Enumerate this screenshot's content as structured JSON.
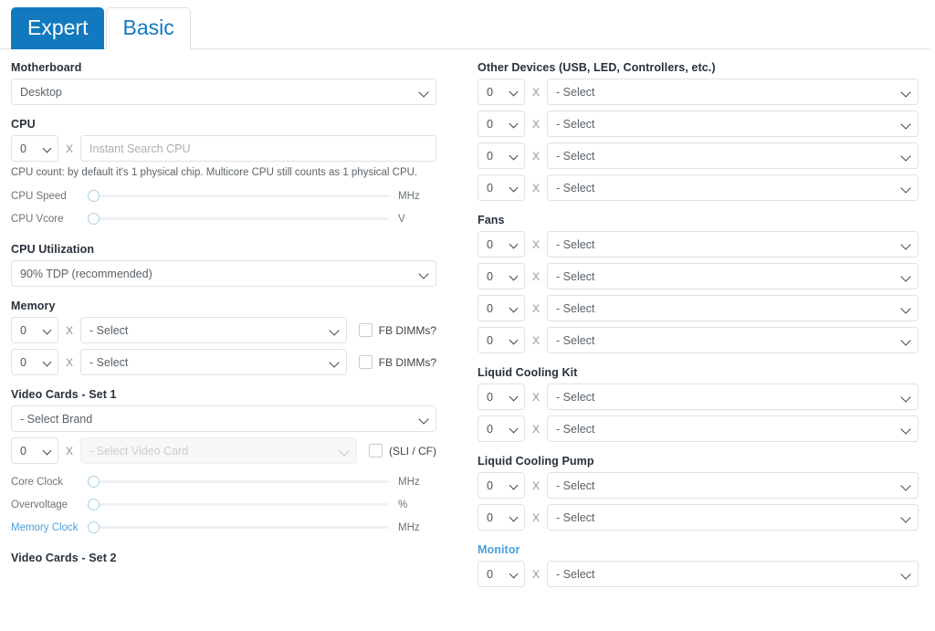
{
  "tabs": [
    {
      "label": "Expert",
      "active": true
    },
    {
      "label": "Basic",
      "active": false
    }
  ],
  "colors": {
    "accent": "#1279bf",
    "link": "#4a9fdb",
    "border": "#dfe1e5",
    "text": "#27313a"
  },
  "left": {
    "motherboard": {
      "label": "Motherboard",
      "value": "Desktop"
    },
    "cpu": {
      "label": "CPU",
      "qty": "0",
      "x": "X",
      "search_placeholder": "Instant Search CPU",
      "help": "CPU count: by default it's 1 physical chip. Multicore CPU still counts as 1 physical CPU.",
      "sliders": [
        {
          "label": "CPU Speed",
          "unit": "MHz",
          "link": false
        },
        {
          "label": "CPU Vcore",
          "unit": "V",
          "link": false
        }
      ]
    },
    "cpu_utilization": {
      "label": "CPU Utilization",
      "value": "90% TDP (recommended)"
    },
    "memory": {
      "label": "Memory",
      "rows": [
        {
          "qty": "0",
          "x": "X",
          "value": "- Select",
          "checkbox_label": "FB DIMMs?",
          "checked": false
        },
        {
          "qty": "0",
          "x": "X",
          "value": "- Select",
          "checkbox_label": "FB DIMMs?",
          "checked": false
        }
      ]
    },
    "video_set1": {
      "label": "Video Cards - Set 1",
      "brand_value": "- Select Brand",
      "qty": "0",
      "x": "X",
      "card_value": "- Select Video Card",
      "card_disabled": true,
      "checkbox_label": "(SLI / CF)",
      "checked": false,
      "sliders": [
        {
          "label": "Core Clock",
          "unit": "MHz",
          "link": false
        },
        {
          "label": "Overvoltage",
          "unit": "%",
          "link": false
        },
        {
          "label": "Memory Clock",
          "unit": "MHz",
          "link": true
        }
      ]
    },
    "video_set2": {
      "label": "Video Cards - Set 2"
    }
  },
  "right": {
    "other_devices": {
      "label": "Other Devices (USB, LED, Controllers, etc.)",
      "rows": [
        {
          "qty": "0",
          "x": "X",
          "value": "- Select"
        },
        {
          "qty": "0",
          "x": "X",
          "value": "- Select"
        },
        {
          "qty": "0",
          "x": "X",
          "value": "- Select"
        },
        {
          "qty": "0",
          "x": "X",
          "value": "- Select"
        }
      ]
    },
    "fans": {
      "label": "Fans",
      "rows": [
        {
          "qty": "0",
          "x": "X",
          "value": "- Select"
        },
        {
          "qty": "0",
          "x": "X",
          "value": "- Select"
        },
        {
          "qty": "0",
          "x": "X",
          "value": "- Select"
        },
        {
          "qty": "0",
          "x": "X",
          "value": "- Select"
        }
      ]
    },
    "liquid_cooling_kit": {
      "label": "Liquid Cooling Kit",
      "rows": [
        {
          "qty": "0",
          "x": "X",
          "value": "- Select"
        },
        {
          "qty": "0",
          "x": "X",
          "value": "- Select"
        }
      ]
    },
    "liquid_cooling_pump": {
      "label": "Liquid Cooling Pump",
      "rows": [
        {
          "qty": "0",
          "x": "X",
          "value": "- Select"
        },
        {
          "qty": "0",
          "x": "X",
          "value": "- Select"
        }
      ]
    },
    "monitor": {
      "label": "Monitor",
      "link": true,
      "rows": [
        {
          "qty": "0",
          "x": "X",
          "value": "- Select"
        }
      ]
    }
  }
}
